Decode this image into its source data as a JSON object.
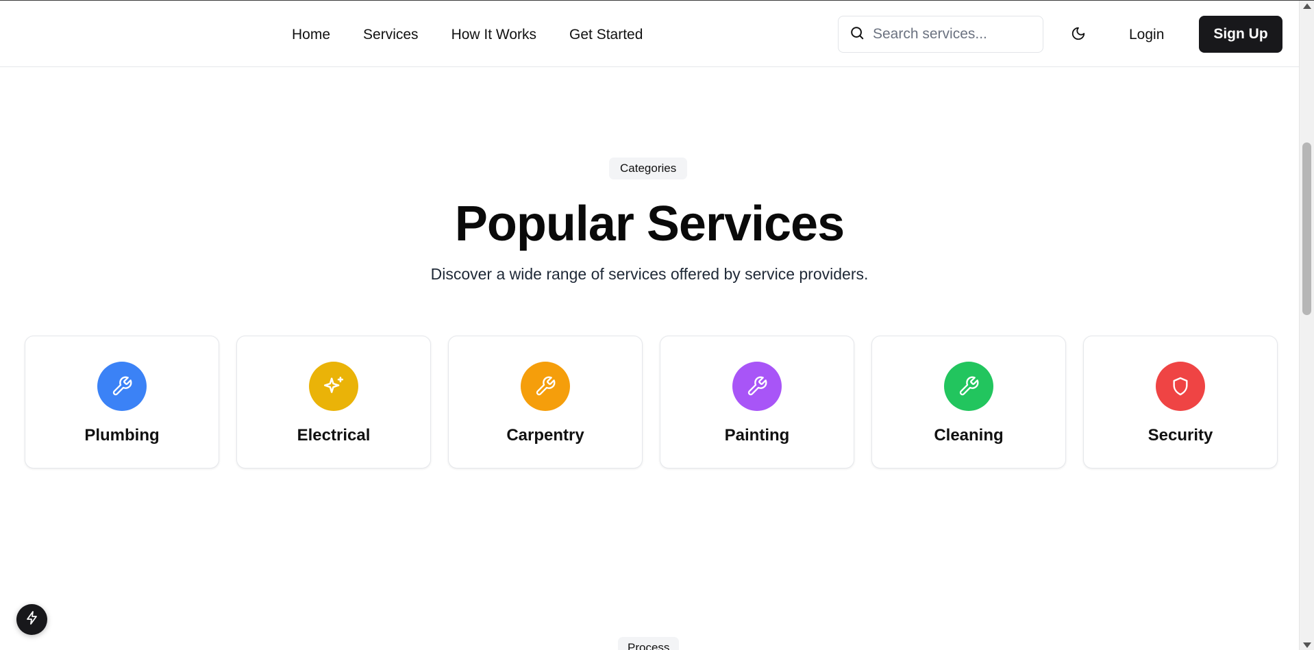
{
  "header": {
    "nav": [
      "Home",
      "Services",
      "How It Works",
      "Get Started"
    ],
    "search_placeholder": "Search services...",
    "login_label": "Login",
    "signup_label": "Sign Up"
  },
  "section": {
    "badge": "Categories",
    "title": "Popular Services",
    "subtitle": "Discover a wide range of services offered by service providers."
  },
  "services": [
    {
      "label": "Plumbing",
      "icon": "wrench-icon",
      "color": "#3b82f6"
    },
    {
      "label": "Electrical",
      "icon": "sparkles-icon",
      "color": "#eab308"
    },
    {
      "label": "Carpentry",
      "icon": "wrench-icon",
      "color": "#f59e0b"
    },
    {
      "label": "Painting",
      "icon": "wrench-icon",
      "color": "#a855f7"
    },
    {
      "label": "Cleaning",
      "icon": "wrench-icon",
      "color": "#22c55e"
    },
    {
      "label": "Security",
      "icon": "shield-icon",
      "color": "#ef4444"
    }
  ],
  "next_section": {
    "badge": "Process"
  },
  "colors": {
    "primary": "#18181b"
  }
}
